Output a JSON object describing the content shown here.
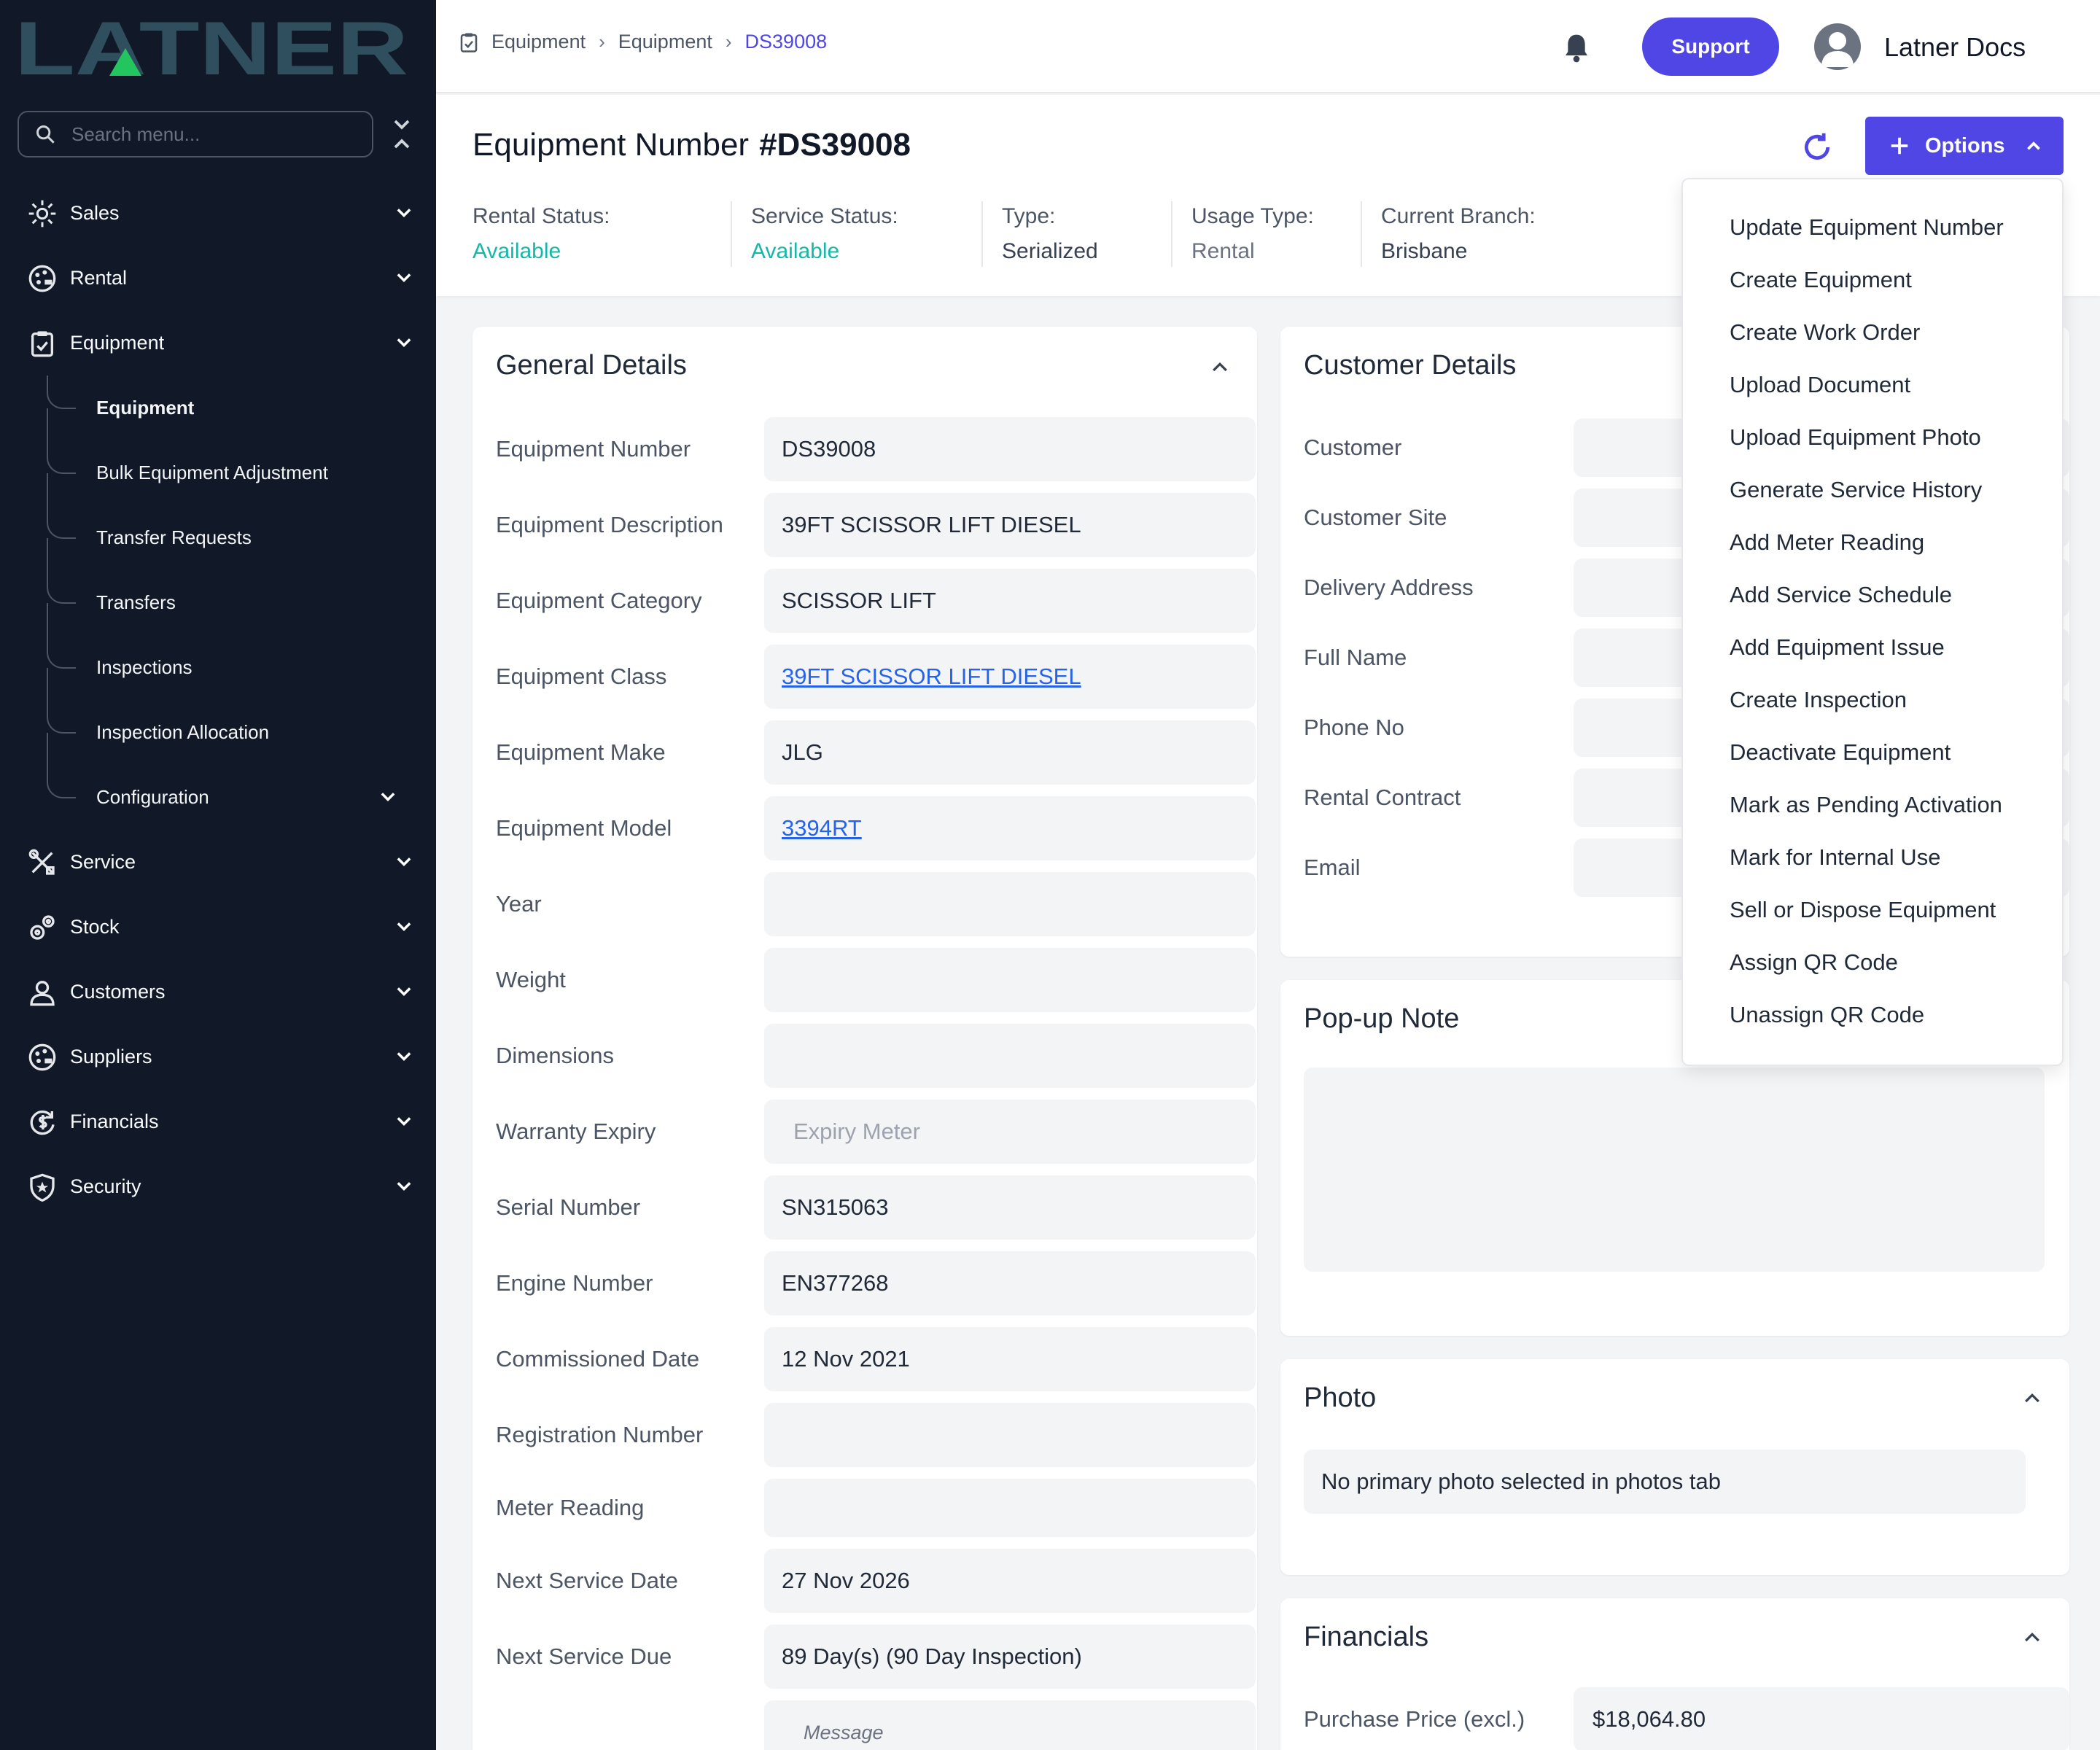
{
  "brand": {
    "logo_text": "LATNER",
    "accent": "#4f46e5"
  },
  "sidebar": {
    "search_placeholder": "Search menu...",
    "items": [
      {
        "label": "Sales",
        "icon": "sun-gear-icon"
      },
      {
        "label": "Rental",
        "icon": "palette-icon"
      },
      {
        "label": "Equipment",
        "icon": "clipboard-icon"
      },
      {
        "label": "Service",
        "icon": "tools-icon"
      },
      {
        "label": "Stock",
        "icon": "cogs-icon"
      },
      {
        "label": "Customers",
        "icon": "user-icon"
      },
      {
        "label": "Suppliers",
        "icon": "palette-icon"
      },
      {
        "label": "Financials",
        "icon": "dollar-cycle-icon"
      },
      {
        "label": "Security",
        "icon": "shield-icon"
      }
    ],
    "equipment_sub": [
      "Equipment",
      "Bulk Equipment Adjustment",
      "Transfer Requests",
      "Transfers",
      "Inspections",
      "Inspection Allocation",
      "Configuration"
    ]
  },
  "topbar": {
    "breadcrumbs": [
      "Equipment",
      "Equipment",
      "DS39008"
    ],
    "support_label": "Support",
    "user_name": "Latner Docs"
  },
  "header": {
    "title_prefix": "Equipment Number",
    "title_number": "#DS39008",
    "options_label": "Options",
    "status": [
      {
        "label": "Rental Status:",
        "value": "Available"
      },
      {
        "label": "Service Status:",
        "value": "Available"
      },
      {
        "label": "Type:",
        "value": "Serialized"
      },
      {
        "label": "Usage Type:",
        "value": "Rental"
      },
      {
        "label": "Current Branch:",
        "value": "Brisbane"
      }
    ]
  },
  "general": {
    "title": "General Details",
    "fields": [
      {
        "label": "Equipment Number",
        "value": "DS39008"
      },
      {
        "label": "Equipment Description",
        "value": "39FT SCISSOR LIFT DIESEL"
      },
      {
        "label": "Equipment Category",
        "value": "SCISSOR LIFT"
      },
      {
        "label": "Equipment Class",
        "value": "39FT SCISSOR LIFT DIESEL"
      },
      {
        "label": "Equipment Make",
        "value": "JLG"
      },
      {
        "label": "Equipment Model",
        "value": "3394RT"
      },
      {
        "label": "Year",
        "value": ""
      },
      {
        "label": "Weight",
        "value": ""
      },
      {
        "label": "Dimensions",
        "value": ""
      },
      {
        "label": "Warranty Expiry",
        "value": "",
        "placeholder": "Expiry Meter"
      },
      {
        "label": "Serial Number",
        "value": "SN315063"
      },
      {
        "label": "Engine Number",
        "value": "EN377268"
      },
      {
        "label": "Commissioned Date",
        "value": "12 Nov 2021"
      },
      {
        "label": "Registration Number",
        "value": ""
      },
      {
        "label": "Meter Reading",
        "value": ""
      },
      {
        "label": "Next Service Date",
        "value": "27 Nov 2026"
      },
      {
        "label": "Next Service Due",
        "value": "89 Day(s) (90 Day Inspection)"
      }
    ],
    "message_placeholder": "Message"
  },
  "customer": {
    "title": "Customer Details",
    "fields": [
      "Customer",
      "Customer Site",
      "Delivery Address",
      "Full Name",
      "Phone No",
      "Rental Contract",
      "Email"
    ]
  },
  "popup_note": {
    "title": "Pop-up Note"
  },
  "photo": {
    "title": "Photo",
    "message": "No primary photo selected in photos tab"
  },
  "financials": {
    "title": "Financials",
    "purchase_label": "Purchase Price (excl.)",
    "purchase_value": "$18,064.80"
  },
  "options_menu": [
    "Update Equipment Number",
    "Create Equipment",
    "Create Work Order",
    "Upload Document",
    "Upload Equipment Photo",
    "Generate Service History",
    "Add Meter Reading",
    "Add Service Schedule",
    "Add Equipment Issue",
    "Create Inspection",
    "Deactivate Equipment",
    "Mark as Pending Activation",
    "Mark for Internal Use",
    "Sell or Dispose Equipment",
    "Assign QR Code",
    "Unassign QR Code"
  ]
}
